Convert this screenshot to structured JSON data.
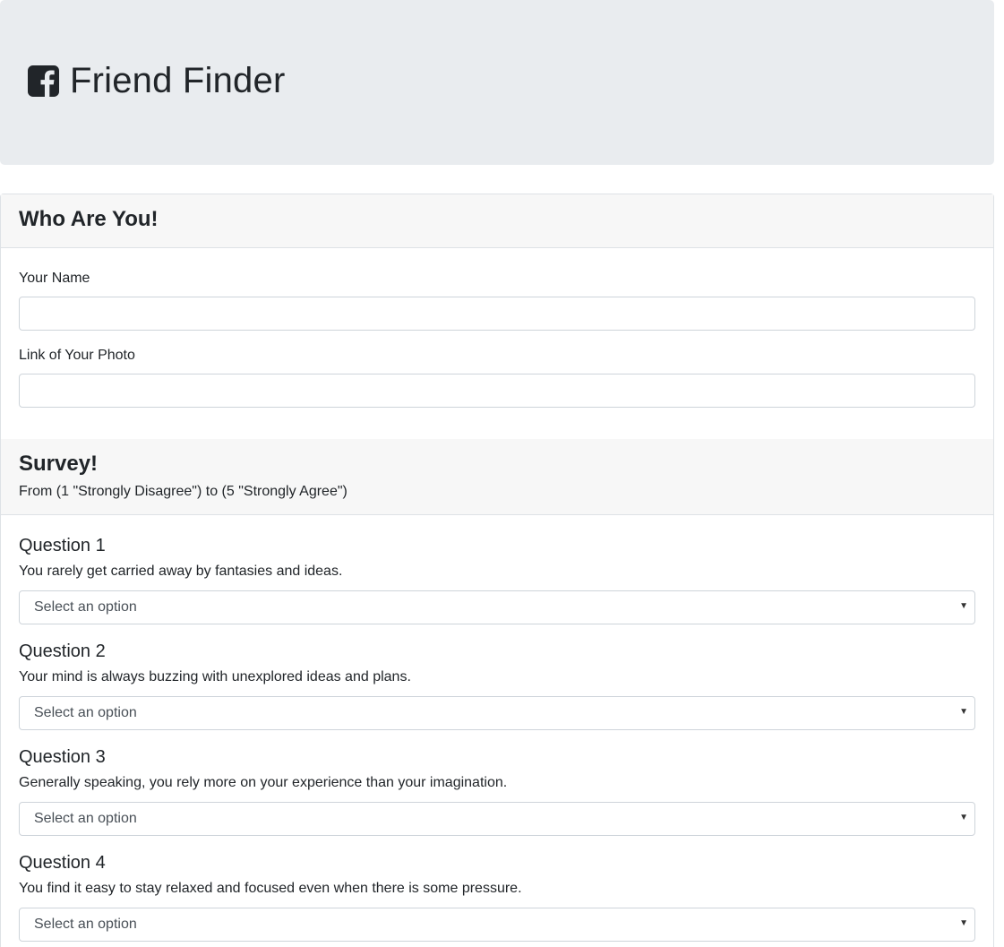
{
  "header": {
    "title": "Friend Finder",
    "icon": "facebook-square-icon"
  },
  "who_are_you": {
    "heading": "Who Are You!",
    "name_label": "Your Name",
    "name_value": "",
    "photo_label": "Link of Your Photo",
    "photo_value": ""
  },
  "survey": {
    "heading": "Survey!",
    "subtitle": "From (1 \"Strongly Disagree\") to (5 \"Strongly Agree\")",
    "questions": [
      {
        "title": "Question 1",
        "text": "You rarely get carried away by fantasies and ideas.",
        "selected": "Select an option"
      },
      {
        "title": "Question 2",
        "text": "Your mind is always buzzing with unexplored ideas and plans.",
        "selected": "Select an option"
      },
      {
        "title": "Question 3",
        "text": "Generally speaking, you rely more on your experience than your imagination.",
        "selected": "Select an option"
      },
      {
        "title": "Question 4",
        "text": "You find it easy to stay relaxed and focused even when there is some pressure.",
        "selected": "Select an option"
      }
    ]
  },
  "colors": {
    "jumbotron_bg": "#e9ecef",
    "card_header_bg": "#f7f7f7",
    "border": "#ced4da",
    "text": "#212529"
  }
}
